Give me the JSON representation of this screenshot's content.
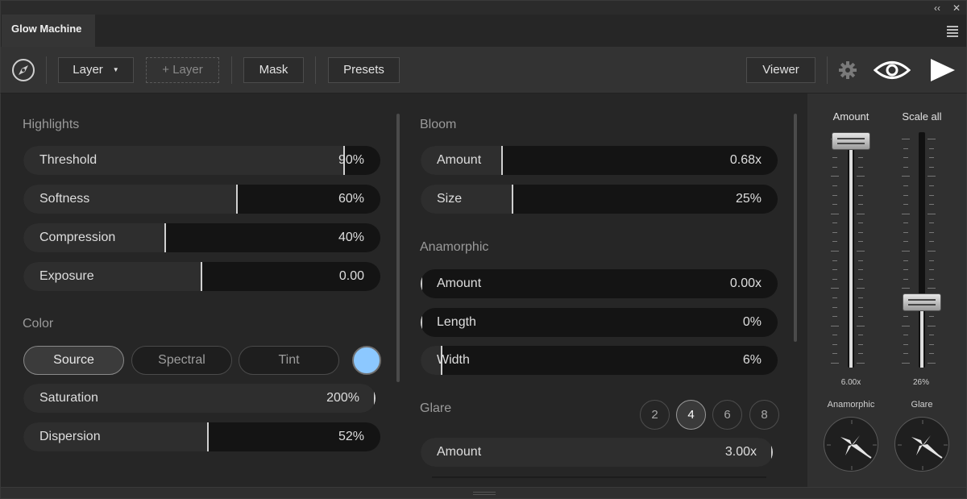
{
  "window": {
    "collapse_glyph": "‹‹",
    "close_glyph": "✕"
  },
  "tab": {
    "title": "Glow Machine"
  },
  "toolbar": {
    "layer_label": "Layer",
    "add_layer_label": "+ Layer",
    "mask_label": "Mask",
    "presets_label": "Presets",
    "viewer_label": "Viewer"
  },
  "highlights": {
    "title": "Highlights",
    "sliders": [
      {
        "label": "Threshold",
        "value": "90%",
        "level": 0.9
      },
      {
        "label": "Softness",
        "value": "60%",
        "level": 0.6
      },
      {
        "label": "Compression",
        "value": "40%",
        "level": 0.4
      },
      {
        "label": "Exposure",
        "value": "0.00",
        "level": 0.5
      }
    ]
  },
  "color": {
    "title": "Color",
    "modes": [
      "Source",
      "Spectral",
      "Tint"
    ],
    "active_mode": "Source",
    "swatch": "#8cc8ff",
    "sliders": [
      {
        "label": "Saturation",
        "value": "200%",
        "level": 1.0
      },
      {
        "label": "Dispersion",
        "value": "52%",
        "level": 0.52
      }
    ]
  },
  "bloom": {
    "title": "Bloom",
    "sliders": [
      {
        "label": "Amount",
        "value": "0.68x",
        "level": 0.23
      },
      {
        "label": "Size",
        "value": "25%",
        "level": 0.26
      }
    ]
  },
  "anamorphic": {
    "title": "Anamorphic",
    "sliders": [
      {
        "label": "Amount",
        "value": "0.00x",
        "level": 0.0
      },
      {
        "label": "Length",
        "value": "0%",
        "level": 0.0
      },
      {
        "label": "Width",
        "value": "6%",
        "level": 0.06
      }
    ]
  },
  "glare": {
    "title": "Glare",
    "counts": [
      "2",
      "4",
      "6",
      "8"
    ],
    "active_count": "4",
    "sliders": [
      {
        "label": "Amount",
        "value": "3.00x",
        "level": 1.0
      }
    ]
  },
  "right_panel": {
    "amount_label": "Amount",
    "scale_label": "Scale all",
    "amount_value": "6.00x",
    "scale_value": "26%",
    "amount_level": 1.0,
    "scale_level": 0.26,
    "anamorphic_label": "Anamorphic",
    "glare_label": "Glare"
  }
}
